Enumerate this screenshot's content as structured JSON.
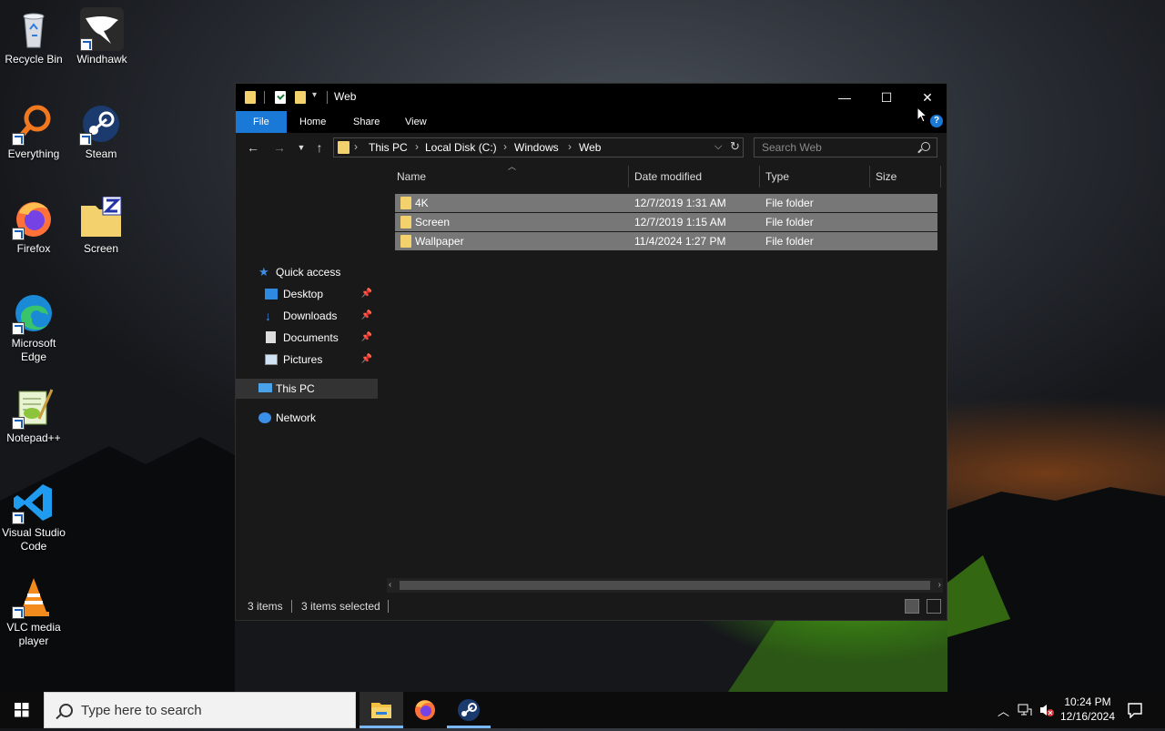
{
  "desktop": {
    "icons": [
      {
        "label": "Recycle Bin",
        "icon": "recycle-bin-icon"
      },
      {
        "label": "Windhawk",
        "icon": "windhawk-icon"
      },
      {
        "label": "Everything",
        "icon": "everything-icon"
      },
      {
        "label": "Steam",
        "icon": "steam-icon"
      },
      {
        "label": "Firefox",
        "icon": "firefox-icon"
      },
      {
        "label": "Screen",
        "icon": "screen-icon"
      },
      {
        "label": "Microsoft Edge",
        "icon": "edge-icon"
      },
      {
        "label": "Notepad++",
        "icon": "notepadpp-icon"
      },
      {
        "label": "Visual Studio Code",
        "icon": "vscode-icon"
      },
      {
        "label": "VLC media player",
        "icon": "vlc-icon"
      }
    ]
  },
  "explorer": {
    "title": "Web",
    "window_controls": {
      "minimize": "—",
      "maximize": "☐",
      "close": "✕"
    },
    "ribbon": {
      "tabs": [
        "File",
        "Home",
        "Share",
        "View"
      ],
      "help": "?"
    },
    "address": {
      "crumbs": [
        "This PC",
        "Local Disk (C:)",
        "Windows",
        "Web"
      ],
      "separator": "›"
    },
    "search": {
      "placeholder": "Search Web"
    },
    "nav": {
      "quick_access": "Quick access",
      "pinned": [
        "Desktop",
        "Downloads",
        "Documents",
        "Pictures"
      ],
      "this_pc": "This PC",
      "network": "Network"
    },
    "columns": [
      "Name",
      "Date modified",
      "Type",
      "Size"
    ],
    "rows": [
      {
        "name": "4K",
        "date": "12/7/2019 1:31 AM",
        "type": "File folder",
        "size": ""
      },
      {
        "name": "Screen",
        "date": "12/7/2019 1:15 AM",
        "type": "File folder",
        "size": ""
      },
      {
        "name": "Wallpaper",
        "date": "11/4/2024 1:27 PM",
        "type": "File folder",
        "size": ""
      }
    ],
    "status": {
      "items": "3 items",
      "selected": "3 items selected"
    }
  },
  "taskbar": {
    "search_placeholder": "Type here to search",
    "apps": [
      "file-explorer-icon",
      "firefox-icon",
      "steam-icon"
    ],
    "clock": {
      "time": "10:24 PM",
      "date": "12/16/2024"
    }
  },
  "colors": {
    "accent": "#1a78d6",
    "folder": "#f3d16c",
    "selected_row": "#777777",
    "window_bg": "#191919"
  }
}
